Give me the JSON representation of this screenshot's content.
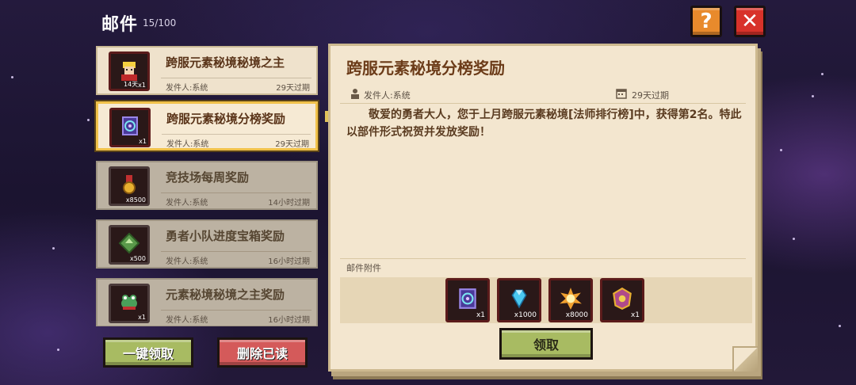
{
  "header": {
    "title": "邮件",
    "count": "15/100",
    "help_icon_glyph": "?",
    "close_icon_glyph": "✕"
  },
  "mail_list": [
    {
      "subject": "跨服元素秘境秘境之主",
      "sender": "发件人:系统",
      "expire": "29天过期",
      "qty": "x1",
      "tag": "14天",
      "icon": "hero-portrait-icon",
      "read": false,
      "selected": false
    },
    {
      "subject": "跨服元素秘境分榜奖励",
      "sender": "发件人:系统",
      "expire": "29天过期",
      "qty": "x1",
      "tag": "",
      "icon": "spell-card-icon",
      "read": false,
      "selected": true
    },
    {
      "subject": "竞技场每周奖励",
      "sender": "发件人:系统",
      "expire": "14小时过期",
      "qty": "x8500",
      "tag": "",
      "icon": "medal-icon",
      "read": true,
      "selected": false
    },
    {
      "subject": "勇者小队进度宝箱奖励",
      "sender": "发件人:系统",
      "expire": "16小时过期",
      "qty": "x500",
      "tag": "",
      "icon": "green-badge-icon",
      "read": true,
      "selected": false
    },
    {
      "subject": "元素秘境秘境之主奖励",
      "sender": "发件人:系统",
      "expire": "16小时过期",
      "qty": "x1",
      "tag": "",
      "icon": "frog-pet-icon",
      "read": true,
      "selected": false
    }
  ],
  "buttons": {
    "claim_all": "一键领取",
    "delete_read": "删除已读",
    "claim": "领取"
  },
  "detail": {
    "subject": "跨服元素秘境分榜奖励",
    "sender": "发件人:系统",
    "expire": "29天过期",
    "body": "敬爱的勇者大人，您于上月跨服元素秘境[法师排行榜]中，获得第2名。特此以部件形式祝贺并发放奖励！",
    "attachments_label": "邮件附件",
    "attachments": [
      {
        "icon": "spell-card-icon",
        "qty": "x1"
      },
      {
        "icon": "diamond-icon",
        "qty": "x1000"
      },
      {
        "icon": "explosion-icon",
        "qty": "x8000"
      },
      {
        "icon": "emblem-icon",
        "qty": "x1"
      }
    ]
  },
  "colors": {
    "panel_bg": "#f3e6cf",
    "selected_border": "#f1c24a",
    "green_button": "#a8bb62",
    "red_button": "#d45a5a",
    "help_button": "#e88a2c",
    "close_button": "#d8322a"
  }
}
